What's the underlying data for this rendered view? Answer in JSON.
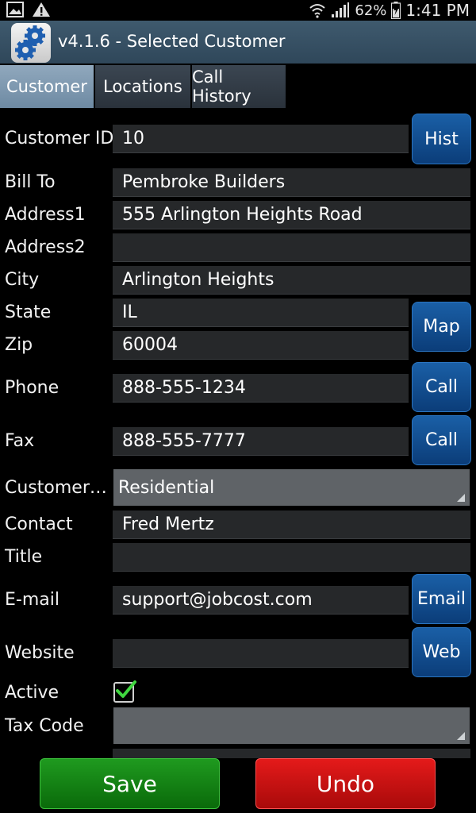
{
  "status_bar": {
    "battery": "62%",
    "time": "1:41 PM"
  },
  "titlebar": {
    "title": "v4.1.6 - Selected Customer"
  },
  "tabs": [
    {
      "label": "Customer",
      "active": true
    },
    {
      "label": "Locations",
      "active": false
    },
    {
      "label": "Call History",
      "active": false
    }
  ],
  "form": {
    "customer_id": {
      "label": "Customer ID",
      "value": "10"
    },
    "bill_to": {
      "label": "Bill To",
      "value": "Pembroke Builders"
    },
    "address1": {
      "label": "Address1",
      "value": "555 Arlington Heights Road"
    },
    "address2": {
      "label": "Address2",
      "value": ""
    },
    "city": {
      "label": "City",
      "value": "Arlington Heights"
    },
    "state": {
      "label": "State",
      "value": "IL"
    },
    "zip": {
      "label": "Zip",
      "value": "60004"
    },
    "phone": {
      "label": "Phone",
      "value": "888-555-1234"
    },
    "fax": {
      "label": "Fax",
      "value": "888-555-7777"
    },
    "customer_type": {
      "label": "Customer…",
      "value": "Residential"
    },
    "contact": {
      "label": "Contact",
      "value": "Fred Mertz"
    },
    "title": {
      "label": "Title",
      "value": ""
    },
    "email": {
      "label": "E-mail",
      "value": "support@jobcost.com"
    },
    "website": {
      "label": "Website",
      "value": ""
    },
    "active": {
      "label": "Active",
      "checked": true
    },
    "tax_code": {
      "label": "Tax Code",
      "value": ""
    }
  },
  "buttons": {
    "hist": "Hist",
    "map": "Map",
    "call_phone": "Call",
    "call_fax": "Call",
    "email": "Email",
    "web": "Web",
    "save": "Save",
    "undo": "Undo"
  },
  "colors": {
    "accent_blue": "#0b4c8f",
    "save_green": "#138a13",
    "undo_red": "#c81010",
    "check_green": "#3fd63f"
  }
}
